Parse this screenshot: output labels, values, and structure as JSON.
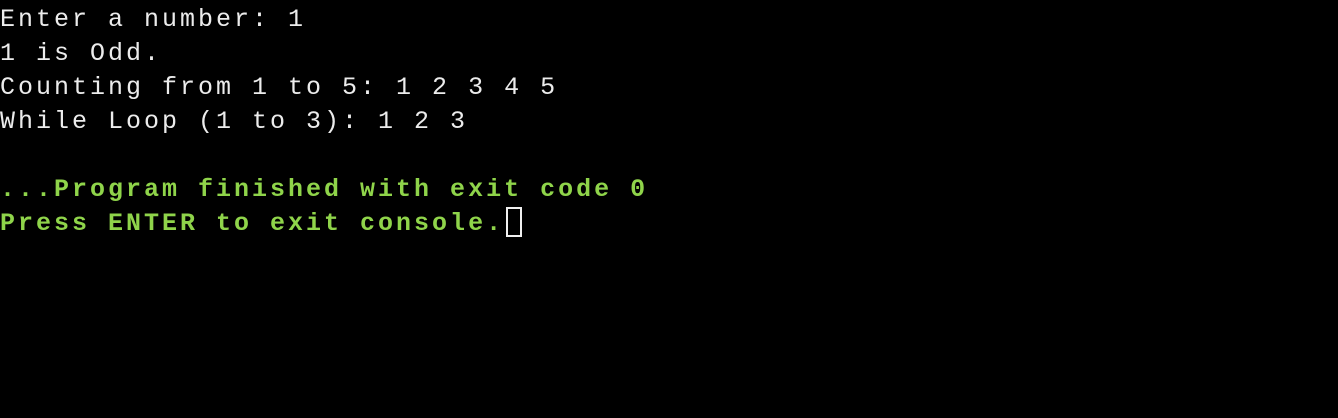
{
  "console": {
    "output_lines": [
      "Enter a number: 1",
      "1 is Odd.",
      "Counting from 1 to 5: 1 2 3 4 5",
      "While Loop (1 to 3): 1 2 3"
    ],
    "finished_message": "...Program finished with exit code 0",
    "exit_prompt": "Press ENTER to exit console.",
    "colors": {
      "background": "#000000",
      "text": "#ececec",
      "status_text": "#8fd44a",
      "cursor_border": "#f0f0f0"
    }
  }
}
